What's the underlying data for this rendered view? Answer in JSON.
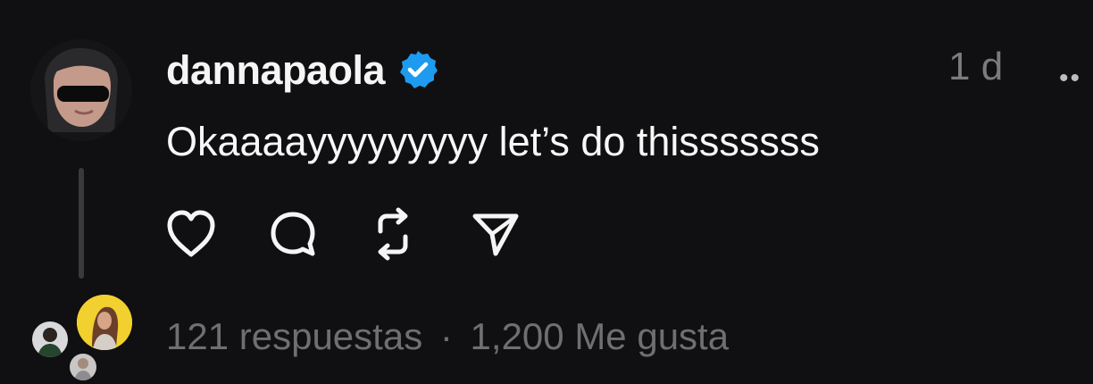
{
  "post": {
    "username": "dannapaola",
    "verified": true,
    "time": "1 d",
    "text": "Okaaaayyyyyyyyy let’s do thisssssss",
    "more_label": "••",
    "replies": "121 respuestas",
    "separator": "·",
    "likes": "1,200 Me gusta"
  },
  "icons": {
    "like": "heart-icon",
    "comment": "comment-icon",
    "repost": "repost-icon",
    "share": "send-icon",
    "verified": "verified-badge-icon"
  },
  "colors": {
    "background": "#100f11",
    "primary_text": "#f5f5f5",
    "secondary_text": "#6f6e71",
    "verified_blue": "#1d9bf0"
  }
}
